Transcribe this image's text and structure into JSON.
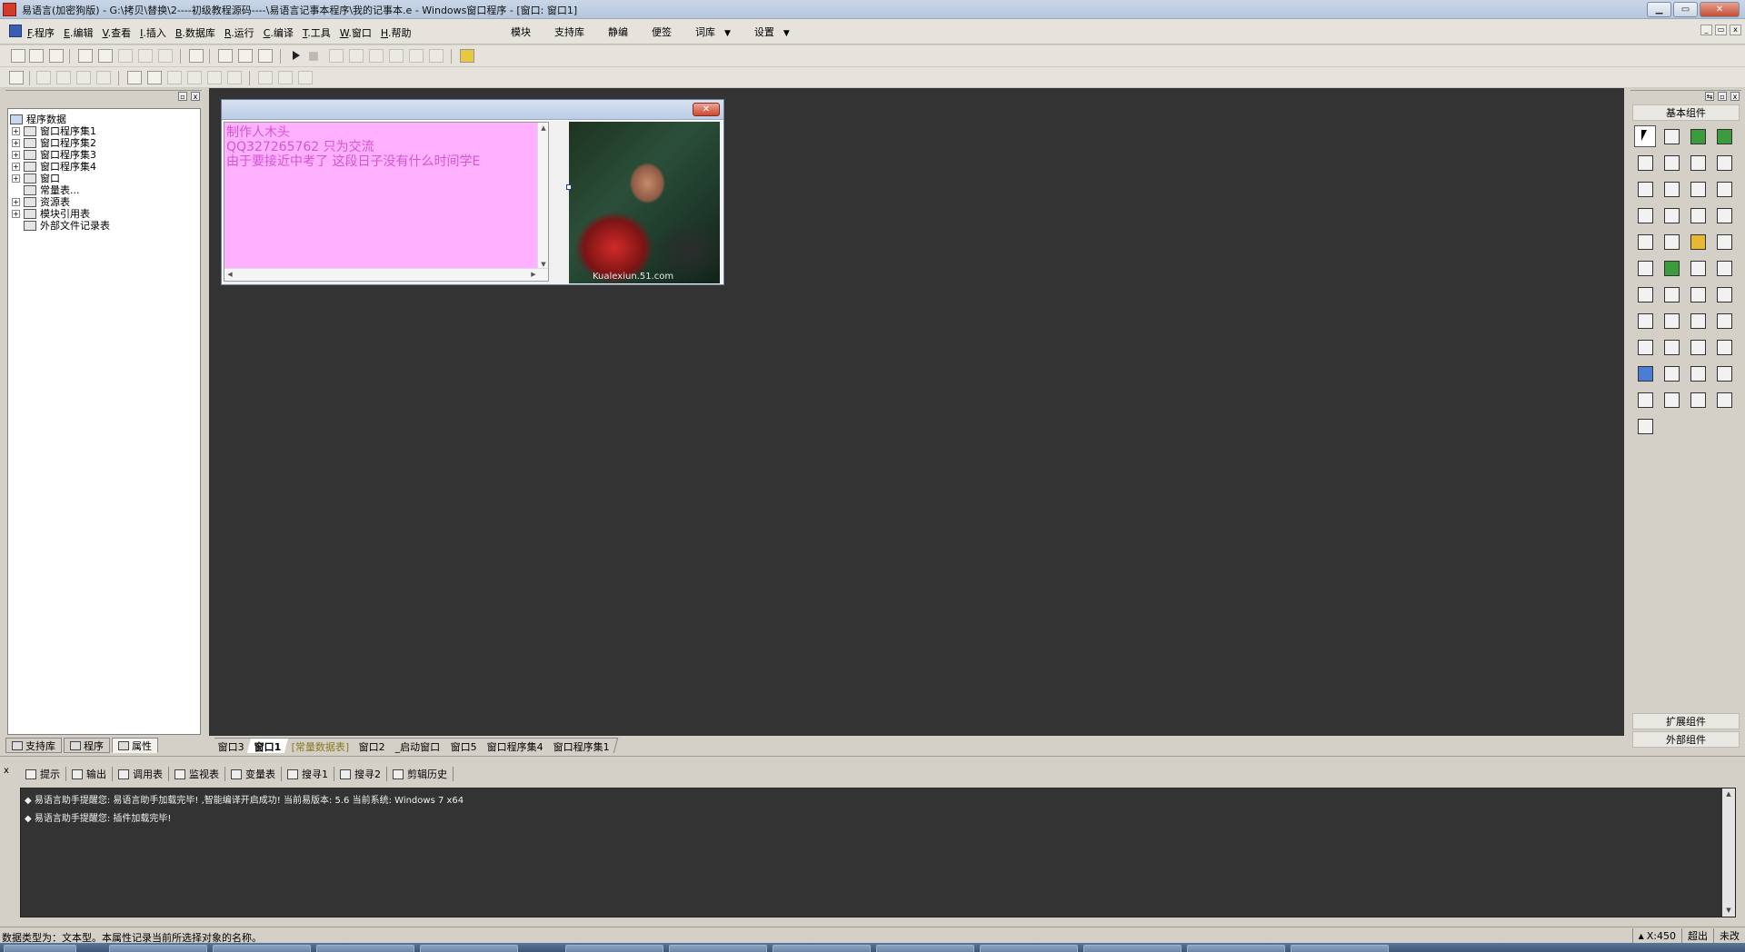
{
  "window": {
    "title": "易语言(加密狗版) - G:\\拷贝\\替换\\2----初级教程源码----\\易语言记事本程序\\我的记事本.e - Windows窗口程序 - [窗口: 窗口1]",
    "min": "▁",
    "max": "▭",
    "close": "✕"
  },
  "menu": {
    "items": [
      {
        "key": "F",
        "label": ".程序"
      },
      {
        "key": "E",
        "label": ".编辑"
      },
      {
        "key": "V",
        "label": ".查看"
      },
      {
        "key": "I",
        "label": ".插入"
      },
      {
        "key": "B",
        "label": ".数据库"
      },
      {
        "key": "R",
        "label": ".运行"
      },
      {
        "key": "C",
        "label": ".编译"
      },
      {
        "key": "T",
        "label": ".工具"
      },
      {
        "key": "W",
        "label": ".窗口"
      },
      {
        "key": "H",
        "label": ".帮助"
      }
    ],
    "extra": [
      "模块",
      "支持库",
      "静编",
      "便签",
      "词库",
      "设置"
    ],
    "dropdown": "▼",
    "mdi": [
      "_",
      "▭",
      "x"
    ]
  },
  "left_panel": {
    "header_buttons": [
      "▫",
      "x"
    ],
    "tree": [
      {
        "label": "程序数据",
        "expander": "",
        "root": true
      },
      {
        "label": "窗口程序集1",
        "expander": "+"
      },
      {
        "label": "窗口程序集2",
        "expander": "+"
      },
      {
        "label": "窗口程序集3",
        "expander": "+"
      },
      {
        "label": "窗口程序集4",
        "expander": "+"
      },
      {
        "label": "窗口",
        "expander": "+"
      },
      {
        "label": "常量表...",
        "expander": ""
      },
      {
        "label": "资源表",
        "expander": "+"
      },
      {
        "label": "模块引用表",
        "expander": "+"
      },
      {
        "label": "外部文件记录表",
        "expander": ""
      }
    ],
    "tabs": [
      "支持库",
      "程序",
      "属性"
    ]
  },
  "form_window": {
    "close": "✕",
    "edit_lines": [
      "制作人木头",
      " QQ327265762  只为交流",
      "由于要接近中考了 这段日子没有什么时间学E"
    ],
    "scroll_up": "▲",
    "scroll_down": "▼",
    "scroll_left": "◀",
    "scroll_right": "▶",
    "photo_watermark": "Kualexiun.51.com"
  },
  "doc_tabs": [
    {
      "label": "窗口3",
      "active": false,
      "constant": false
    },
    {
      "label": "窗口1",
      "active": true,
      "constant": false
    },
    {
      "label": "[常量数据表]",
      "active": false,
      "constant": true
    },
    {
      "label": "窗口2",
      "active": false,
      "constant": false
    },
    {
      "label": "_启动窗口",
      "active": false,
      "constant": false
    },
    {
      "label": "窗口5",
      "active": false,
      "constant": false
    },
    {
      "label": "窗口程序集4",
      "active": false,
      "constant": false
    },
    {
      "label": "窗口程序集1",
      "active": false,
      "constant": false
    }
  ],
  "right_panel": {
    "header_buttons": [
      "⇆",
      "▫",
      "x"
    ],
    "title": "基本组件",
    "tool_count": 45,
    "extended": "扩展组件",
    "external": "外部组件"
  },
  "output_panel": {
    "close": "x",
    "tabs": [
      "提示",
      "输出",
      "调用表",
      "监视表",
      "变量表",
      "搜寻1",
      "搜寻2",
      "剪辑历史"
    ],
    "lines": [
      "◆ 易语言助手提醒您: 易语言助手加载完毕! ,智能编译开启成功! 当前易版本: 5.6  当前系统: Windows 7 x64",
      "◆ 易语言助手提醒您: 插件加载完毕!"
    ],
    "scroll_up": "▲",
    "scroll_down": "▼"
  },
  "status": {
    "text": "数据类型为：文本型。本属性记录当前所选择对象的名称。",
    "coord": "X:450",
    "mode1": "超出",
    "mode2": "未改"
  }
}
